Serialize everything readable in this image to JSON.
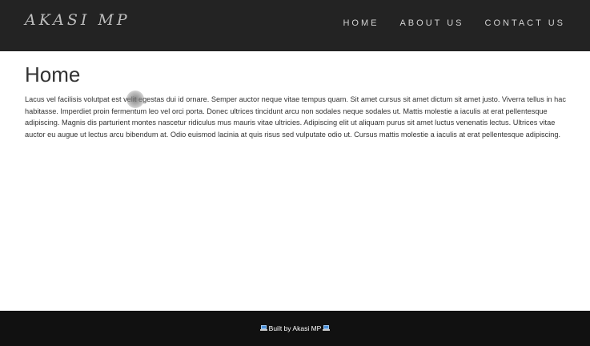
{
  "header": {
    "logo_text": "AKASI MP",
    "nav": [
      {
        "label": "HOME"
      },
      {
        "label": "ABOUT US"
      },
      {
        "label": "CONTACT US"
      }
    ]
  },
  "main": {
    "title": "Home",
    "paragraph": "Lacus vel facilisis volutpat est velit egestas dui id ornare. Semper auctor neque vitae tempus quam. Sit amet cursus sit amet dictum sit amet justo. Viverra tellus in hac habitasse. Imperdiet proin fermentum leo vel orci porta. Donec ultrices tincidunt arcu non sodales neque sodales ut. Mattis molestie a iaculis at erat pellentesque adipiscing. Magnis dis parturient montes nascetur ridiculus mus mauris vitae ultricies. Adipiscing elit ut aliquam purus sit amet luctus venenatis lectus. Ultrices vitae auctor eu augue ut lectus arcu bibendum at. Odio euismod lacinia at quis risus sed vulputate odio ut. Cursus mattis molestie a iaculis at erat pellentesque adipiscing."
  },
  "footer": {
    "text": "Built by Akasi MP",
    "icons": [
      "laptop-icon",
      "laptop-icon"
    ]
  },
  "colors": {
    "header_bg": "#232323",
    "footer_bg": "#111111",
    "text": "#333333",
    "nav_text": "#d3d3d3"
  }
}
